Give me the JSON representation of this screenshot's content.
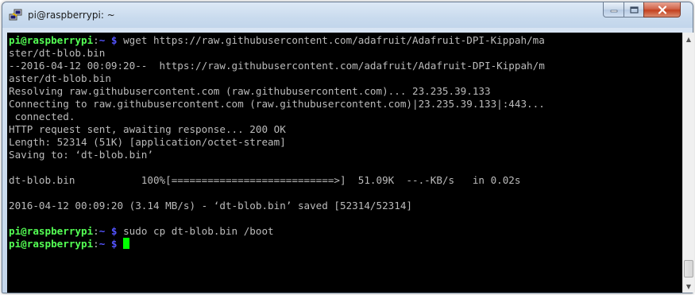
{
  "window": {
    "title": "pi@raspberrypi: ~",
    "icon": "putty-icon",
    "controls": {
      "minimize": "minimize-icon",
      "maximize": "maximize-icon",
      "close": "close-icon"
    }
  },
  "colors": {
    "terminal_bg": "#000000",
    "text": "#bbbbbb",
    "prompt_user": "#54ff54",
    "prompt_path": "#5454ff",
    "cursor": "#00ff00"
  },
  "prompt": {
    "user_host": "pi@raspberrypi",
    "sep": ":",
    "path": "~ $"
  },
  "terminal": {
    "cmd1_a": " wget https://raw.githubusercontent.com/adafruit/Adafruit-DPI-Kippah/ma",
    "cmd1_b": "ster/dt-blob.bin",
    "l3": "--2016-04-12 00:09:20--  https://raw.githubusercontent.com/adafruit/Adafruit-DPI-Kippah/m",
    "l4": "aster/dt-blob.bin",
    "l5": "Resolving raw.githubusercontent.com (raw.githubusercontent.com)... 23.235.39.133",
    "l6": "Connecting to raw.githubusercontent.com (raw.githubusercontent.com)|23.235.39.133|:443...",
    "l7": " connected.",
    "l8": "HTTP request sent, awaiting response... 200 OK",
    "l9": "Length: 52314 (51K) [application/octet-stream]",
    "l10": "Saving to: ‘dt-blob.bin’",
    "l12": "dt-blob.bin           100%[===========================>]  51.09K  --.-KB/s   in 0.02s",
    "l14": "2016-04-12 00:09:20 (3.14 MB/s) - ‘dt-blob.bin’ saved [52314/52314]",
    "cmd2": " sudo cp dt-blob.bin /boot"
  }
}
